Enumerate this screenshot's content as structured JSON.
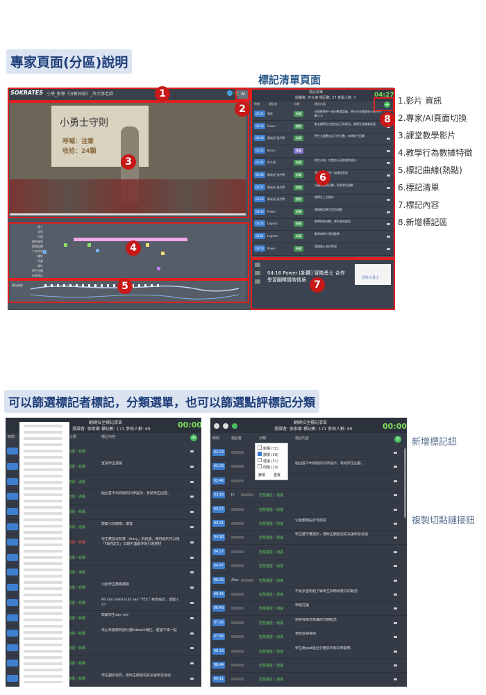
{
  "section1": {
    "title": "專家頁面(分區)說明",
    "list_title": "標記清單頁面",
    "brand": "SOKRATES",
    "video_title": "小學_數學《分數探險》_許大偉老師",
    "ai_toggle": "AI",
    "list_header_title": "標記清單",
    "list_header_sub": "授課者: 許大偉 標記數: 27 參與人數: 7",
    "list_timer": "04:27",
    "list_columns": [
      "時間",
      "標記者",
      "分類",
      "標記內容"
    ],
    "classroom_board_text": "小勇士守則",
    "board_line2": "呼喊：注意",
    "board_line3": "收拾：24顆",
    "heat_label": "標記曲線",
    "feature_rows": [
      "個人",
      "全班",
      "分組",
      "個別指導",
      "提問回饋",
      "二次作答",
      "講評",
      "作業",
      "操作",
      "學生回應",
      "作答統計"
    ],
    "note_text": "04:16 Power [新購] 冒險勇士 合作學習圖釋冒險情境",
    "note_image_text": "冒險小勇士",
    "list_rows": [
      {
        "time": "00:21",
        "who": "張鈺",
        "tag": "新購",
        "note": "這個數學把一個分數題冒險，學生在這裡拿到小勇士分數小卡"
      },
      {
        "time": "00:33",
        "who": "Power",
        "tag": "讚譽",
        "note": "點名讓學生先說出自己的想法，讓學生有機會表達"
      },
      {
        "time": "00:40",
        "who": "陳淑貞 張丹菁",
        "tag": "新購",
        "note": "學生大聲數出自己的分數，老師給予回饋"
      },
      {
        "time": "01:22",
        "who": "Bruce",
        "tag": "建議",
        "note": ""
      },
      {
        "time": "01:45",
        "who": "許大偉",
        "tag": "新購",
        "note": "學生分組，討論並分享各組的想法"
      },
      {
        "time": "02:00",
        "who": "陳淑貞 張丹菁",
        "tag": "新購",
        "note": "老師帶領全班一起確認答案"
      },
      {
        "time": "02:37",
        "who": "陳淑貞 張丹菁",
        "tag": "新購",
        "note": "以圖像說明分數，幫助學生理解"
      },
      {
        "time": "03:10",
        "who": "陳淑貞 張丹菁",
        "tag": "讚譽",
        "note": "讓學生上台操作"
      },
      {
        "time": "03:33",
        "who": "Power",
        "tag": "新購",
        "note": "重複確認學生是否理解"
      },
      {
        "time": "03:55",
        "who": "Legend",
        "tag": "新購",
        "note": "教學節奏流暢，學生參與度高"
      },
      {
        "time": "04:01",
        "who": "Legend",
        "tag": "新購",
        "note": "數學教學小學習數學"
      },
      {
        "time": "04:16",
        "who": "Power",
        "tag": "新購",
        "note": "冒險勇士合作學習"
      }
    ]
  },
  "legend": [
    "1.影片 資訊",
    "2.專家/AI頁面切換",
    "3.課堂教學影片",
    "4.教學行為數據特徵",
    "5.標記曲線(熱點)",
    "6.標記清單",
    "7.標記內容",
    "8.新增標記區"
  ],
  "section2": {
    "title": "可以篩選標記者標記，分類選單，也可以篩選點評標記分類",
    "list_header_title": "翻轉拉坐標記清單",
    "list_header_sub": "授課者: 張家樂 標記數: 171 參與人數: 69",
    "timer": "00:00",
    "columns": [
      "時間",
      "標記者",
      "分類",
      "標記內容"
    ],
    "filter_options": [
      {
        "label": "新購 (72)",
        "checked": false
      },
      {
        "label": "讚揚 (58)",
        "checked": true
      },
      {
        "label": "建議 (31)",
        "checked": false
      },
      {
        "label": "問題 (19)",
        "checked": false
      }
    ],
    "filter_buttons": [
      "篩選",
      "重置"
    ],
    "annot_add": "新增標記鈕",
    "annot_copy": "複製切點鏈接鈕",
    "left_rows": [
      {
        "tag": "讚揚・新購",
        "note": ""
      },
      {
        "tag": "讚揚・新購",
        "note": "宣揚學生讚揚"
      },
      {
        "tag": "讚揚・通識",
        "note": ""
      },
      {
        "tag": "讚揚・通識",
        "note": "給回答不出問題的同學提示，有助學生回答。"
      },
      {
        "tag": "讚揚・新購",
        "note": ""
      },
      {
        "tag": "讚揚・通識",
        "note": "鼓勵引發動機，讚賞"
      },
      {
        "tag": "讚揚・新購",
        "note": "學生應該沒有寫「diary」的經驗，藉材紙則可以用「FB的貼文」日期不連續作為引導題材"
      },
      {
        "tag": "讚揚・新購",
        "note": ""
      },
      {
        "tag": "讚揚・通識",
        "note": ""
      },
      {
        "tag": "讚揚・新購",
        "note": "引起學生動機讚揚"
      },
      {
        "tag": "讚揚・新購",
        "note": "All you need is to say \"YES.\" 新奇提示，激勵人心！"
      },
      {
        "tag": "讚揚・新購",
        "note": "鼓勵學生say yes"
      },
      {
        "tag": "讚揚・新購",
        "note": "日記日期按照部分讀hiteach環住，建議下移一點"
      },
      {
        "tag": "讚揚・新購",
        "note": ""
      },
      {
        "tag": "讚揚・新購",
        "note": ""
      },
      {
        "tag": "讚揚・新購",
        "note": "學生翻折很高，老師主動營造氣氛讓學習消退"
      }
    ],
    "right_rows": [
      {
        "time": "02:23",
        "who": "",
        "tag": "",
        "note": ""
      },
      {
        "time": "02:29",
        "who": "",
        "tag": "",
        "note": "給回答不出問題的同學提示，有助學生回答。"
      },
      {
        "time": "02:40",
        "who": "",
        "tag": "",
        "note": ""
      },
      {
        "time": "03:19",
        "who": "Jo",
        "tag": "智慧課堂・通識",
        "note": ""
      },
      {
        "time": "03:27",
        "who": "",
        "tag": "智慧課堂・通識",
        "note": ""
      },
      {
        "time": "03:31",
        "who": "",
        "tag": "智慧課堂・通識",
        "note": "引起動機設計有創意"
      },
      {
        "time": "04:18",
        "who": "",
        "tag": "智慧課堂・通識",
        "note": "學生聽不懂指示，老師主動營造氣氛讓學習消退"
      },
      {
        "time": "04:37",
        "who": "",
        "tag": "智慧課堂・通識",
        "note": ""
      },
      {
        "time": "04:47",
        "who": "",
        "tag": "智慧課堂・通識",
        "note": ""
      },
      {
        "time": "06:05",
        "who": "Alex",
        "tag": "智慧課堂・通識",
        "note": ""
      },
      {
        "time": "06:16",
        "who": "",
        "tag": "智慧課堂・通識",
        "note": "不就多重問題了解學生對時間英文的概念"
      },
      {
        "time": "06:43",
        "who": "",
        "tag": "智慧課堂・通識",
        "note": "學組討論"
      },
      {
        "time": "07:26",
        "who": "",
        "tag": "智慧課堂・通識",
        "note": "題目有跨自我課的日期概念"
      },
      {
        "time": "07:56",
        "who": "",
        "tag": "智慧課堂・通識",
        "note": "老師巡視各組"
      },
      {
        "time": "08:13",
        "who": "",
        "tag": "智慧課堂・通識",
        "note": "學生用pad接至中螢供所有同學觀摩。"
      },
      {
        "time": "08:44",
        "who": "",
        "tag": "智慧課堂・通識",
        "note": ""
      },
      {
        "time": "09:11",
        "who": "",
        "tag": "智慧課堂・通識",
        "note": ""
      }
    ]
  }
}
